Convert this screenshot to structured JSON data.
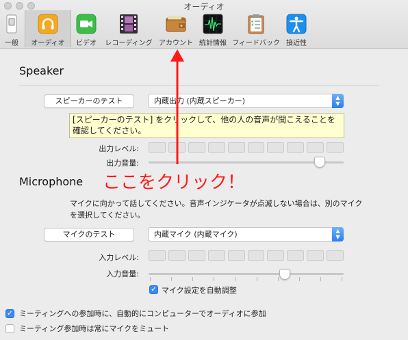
{
  "window": {
    "title": "オーディオ"
  },
  "toolbar": {
    "tabs": [
      {
        "label": "一般",
        "icon": "switch-icon"
      },
      {
        "label": "オーディオ",
        "icon": "headphones-icon",
        "active": true
      },
      {
        "label": "ビデオ",
        "icon": "video-camera-icon"
      },
      {
        "label": "レコーディング",
        "icon": "film-strip-icon"
      },
      {
        "label": "アカウント",
        "icon": "wallet-icon"
      },
      {
        "label": "統計情報",
        "icon": "stats-graph-icon"
      },
      {
        "label": "フィードバック",
        "icon": "clipboard-icon"
      },
      {
        "label": "接近性",
        "icon": "accessibility-icon"
      }
    ]
  },
  "speaker": {
    "heading": "Speaker",
    "test_button": "スピーカーのテスト",
    "device": "内蔵出力 (内蔵スピーカー)",
    "tooltip": "[スピーカーのテスト] をクリックして、他の人の音声が聞こえることを確認してください。",
    "level_label": "出力レベル:",
    "volume_label": "出力音量:",
    "volume_level": 0.9
  },
  "microphone": {
    "heading": "Microphone",
    "description": "マイクに向かって話してください。音声インジケータが点滅しない場合は、別のマイクを選択してください。",
    "test_button": "マイクのテスト",
    "device": "内蔵マイク (内蔵マイク)",
    "level_label": "入力レベル:",
    "volume_label": "入力音量:",
    "volume_level": 0.71,
    "auto_adjust_label": "マイク設定を自動調整",
    "auto_adjust_checked": true
  },
  "options": {
    "join_audio_label": "ミーティングへの参加時に、自動的にコンピューターでオーディオに参加",
    "join_audio_checked": true,
    "mute_mic_label": "ミーティング参加時は常にマイクをミュート",
    "mute_mic_checked": false
  },
  "annotation": {
    "text": "ここをクリック！",
    "color": "#ff1a1a"
  },
  "colors": {
    "accent": "#3b8af7",
    "annotation": "#ff1a1a"
  }
}
